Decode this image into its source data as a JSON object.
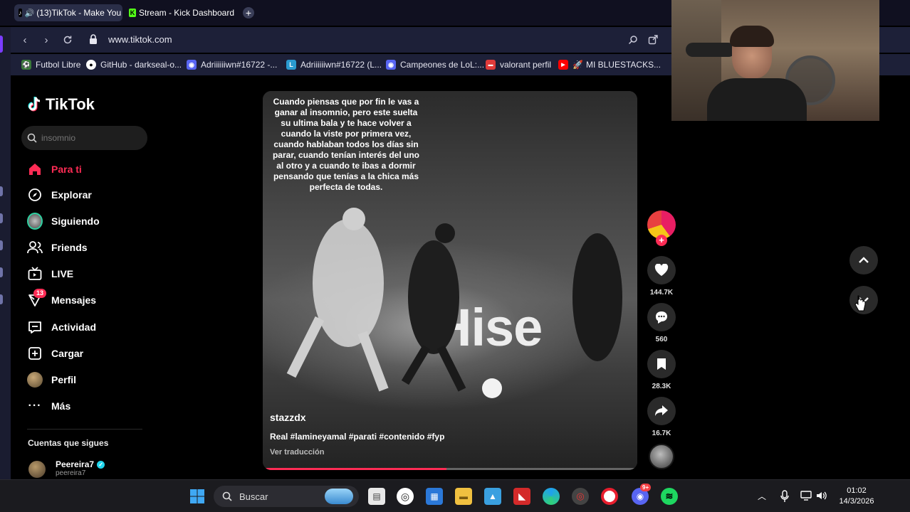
{
  "browser": {
    "tabs": [
      {
        "label": "(13)TikTok - Make You",
        "active": true
      },
      {
        "label": "Stream - Kick Dashboard",
        "active": false
      }
    ],
    "url": "www.tiktok.com",
    "bookmarks": [
      {
        "label": "Futbol Libre",
        "icon": "futbol-icon"
      },
      {
        "label": "GitHub - darkseal-o...",
        "icon": "github-icon"
      },
      {
        "label": "Adriiiiiiwn#16722 -...",
        "icon": "discord-icon"
      },
      {
        "label": "Adriiiiiiwn#16722 (L...",
        "icon": "leagueofgraphs-icon"
      },
      {
        "label": "Campeones de LoL:...",
        "icon": "discord-icon"
      },
      {
        "label": "valorant perfil",
        "icon": "tracker-icon"
      },
      {
        "label": "MI BLUESTACKS...",
        "icon": "youtube-icon"
      }
    ]
  },
  "tiktok": {
    "logo_text": "TikTok",
    "search_placeholder": "insomnio",
    "nav": [
      {
        "label": "Para ti",
        "icon": "home-icon",
        "active": true
      },
      {
        "label": "Explorar",
        "icon": "compass-icon"
      },
      {
        "label": "Siguiendo",
        "icon": "following-avatar-icon"
      },
      {
        "label": "Friends",
        "icon": "friends-icon"
      },
      {
        "label": "LIVE",
        "icon": "live-tv-icon"
      },
      {
        "label": "Mensajes",
        "icon": "messages-icon",
        "badge": "13"
      },
      {
        "label": "Actividad",
        "icon": "activity-icon"
      },
      {
        "label": "Cargar",
        "icon": "upload-icon"
      },
      {
        "label": "Perfil",
        "icon": "profile-avatar-icon"
      },
      {
        "label": "Más",
        "icon": "more-icon"
      }
    ],
    "following_title": "Cuentas que sigues",
    "following": [
      {
        "name": "Peereira7",
        "handle": "peereira7",
        "verified": true
      }
    ],
    "video": {
      "caption": "Cuando piensas que por fin le vas a ganar al insomnio, pero este suelta su ultima bala y te hace volver a cuando la viste por primera vez, cuando hablaban todos los días sin parar, cuando tenían interés del uno al otro y a cuando te ibas a dormir pensando que tenías a la chica más perfecta de todas.",
      "background_text": "Hise",
      "author": "stazzdx",
      "description": "Real #lamineyamal #parati #contenido #fyp",
      "translate": "Ver traducción",
      "progress": 0.49
    },
    "actions": {
      "likes": "144.7K",
      "comments": "560",
      "saves": "28.3K",
      "shares": "16.7K"
    }
  },
  "taskbar": {
    "search_label": "Buscar",
    "time": "01:02",
    "date": "14/3/2026",
    "discord_badge": "9+"
  },
  "colors": {
    "accent": "#fe2c55",
    "browser_bg": "#1d2038",
    "taskbar_bg": "#1b1b1f"
  }
}
